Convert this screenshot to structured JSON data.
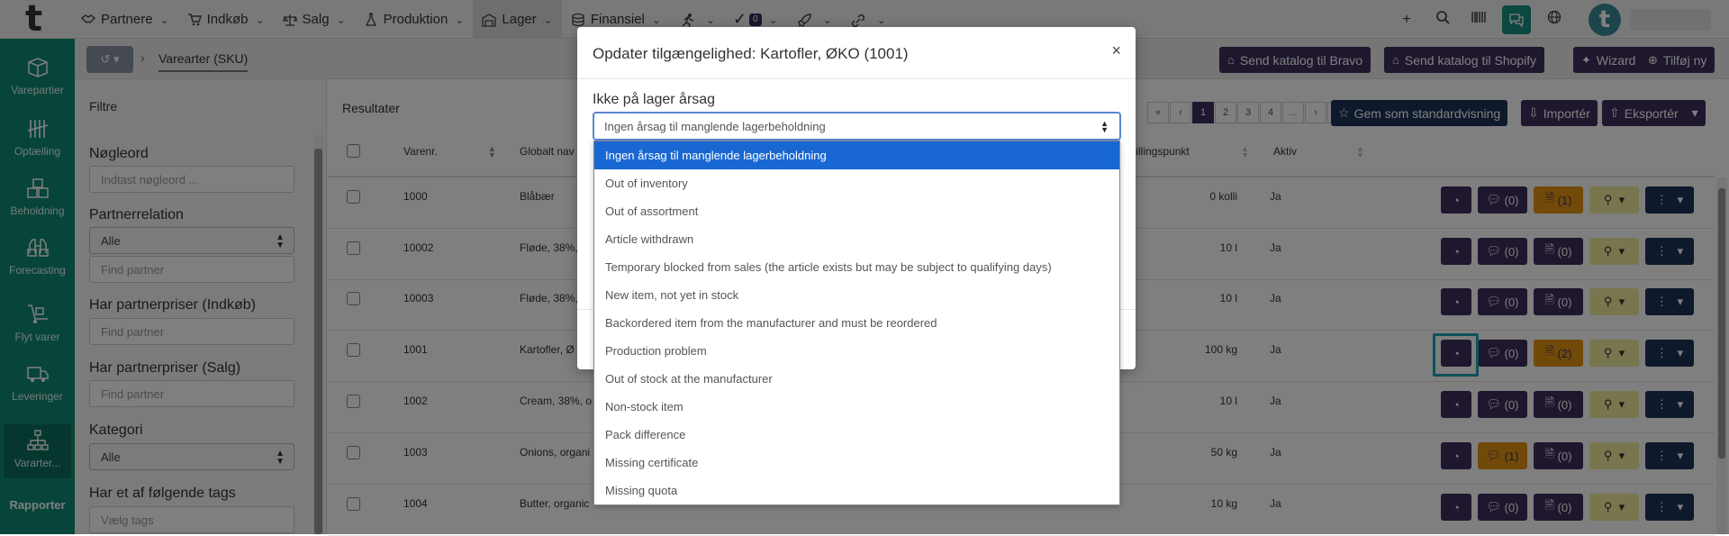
{
  "topnav": {
    "items": [
      {
        "label": "Partnere",
        "icon": "handshake-icon"
      },
      {
        "label": "Indkøb",
        "icon": "cart-icon"
      },
      {
        "label": "Salg",
        "icon": "scale-icon"
      },
      {
        "label": "Produktion",
        "icon": "flask-icon"
      },
      {
        "label": "Lager",
        "icon": "warehouse-icon",
        "active": true
      },
      {
        "label": "Finansiel",
        "icon": "coins-icon"
      }
    ],
    "tasks_badge": "0"
  },
  "sidebar": {
    "items": [
      {
        "label": "Varepartier",
        "icon": "box-icon"
      },
      {
        "label": "Optælling",
        "icon": "tally-icon"
      },
      {
        "label": "Beholdning",
        "icon": "boxes-icon"
      },
      {
        "label": "Forecasting",
        "icon": "binoculars-icon"
      },
      {
        "label": "Flyt varer",
        "icon": "dolly-icon"
      },
      {
        "label": "Leveringer",
        "icon": "truck-icon"
      },
      {
        "label": "Vararter...",
        "icon": "sitemap-icon",
        "active": true
      }
    ],
    "reports_label": "Rapporter"
  },
  "breadcrumb": {
    "current": "Varearter (SKU)"
  },
  "header_buttons": {
    "bravo": "Send katalog til Bravo",
    "shopify": "Send katalog til Shopify",
    "wizard": "Wizard",
    "add": "Tilføj ny"
  },
  "filters": {
    "title": "Filtre",
    "keyword_label": "Nøgleord",
    "keyword_placeholder": "Indtast nøgleord ...",
    "partner_relation_label": "Partnerrelation",
    "partner_relation_value": "Alle",
    "find_partner_placeholder": "Find partner",
    "purchase_prices_label": "Har partnerpriser (Indkøb)",
    "sales_prices_label": "Har partnerpriser (Salg)",
    "category_label": "Kategori",
    "category_value": "Alle",
    "tags_label": "Har et af følgende tags",
    "tags_placeholder": "Vælg tags"
  },
  "results": {
    "title": "Resultater",
    "pages": [
      "«",
      "‹",
      "1",
      "2",
      "3",
      "4",
      "...",
      "›",
      "»"
    ],
    "active_page": "1",
    "save_default": "Gem som standardvisning",
    "import": "Importér",
    "export": "Eksportér",
    "columns": {
      "varenr": "Varenr.",
      "global_name": "Globalt nav",
      "reorder_point": "stillingspunkt",
      "active": "Aktiv"
    },
    "rows": [
      {
        "varenr": "1000",
        "name": "Blåbær",
        "reorder": "0 kolli",
        "active": "Ja",
        "chat": "(0)",
        "docs": "(1)",
        "docs_hl": true,
        "chat_hl": false
      },
      {
        "varenr": "10002",
        "name": "Fløde, 38%,",
        "reorder": "10 l",
        "active": "Ja",
        "chat": "(0)",
        "docs": "(0)",
        "docs_hl": false,
        "chat_hl": false
      },
      {
        "varenr": "10003",
        "name": "Fløde, 38%,",
        "reorder": "10 l",
        "active": "Ja",
        "chat": "(0)",
        "docs": "(0)",
        "docs_hl": false,
        "chat_hl": false
      },
      {
        "varenr": "1001",
        "name": "Kartofler, Ø",
        "reorder": "100 kg",
        "active": "Ja",
        "chat": "(0)",
        "docs": "(2)",
        "docs_hl": true,
        "chat_hl": false
      },
      {
        "varenr": "1002",
        "name": "Cream, 38%, o",
        "reorder": "10 l",
        "active": "Ja",
        "chat": "(0)",
        "docs": "(0)",
        "docs_hl": false,
        "chat_hl": false
      },
      {
        "varenr": "1003",
        "name": "Onions, organi",
        "reorder": "50 kg",
        "active": "Ja",
        "chat": "(1)",
        "docs": "(0)",
        "docs_hl": false,
        "chat_hl": true
      },
      {
        "varenr": "1004",
        "name": "Butter, organic",
        "reorder": "10 kg",
        "active": "Ja",
        "chat": "(0)",
        "docs": "(0)",
        "docs_hl": false,
        "chat_hl": false
      }
    ]
  },
  "modal": {
    "title": "Opdater tilgængelighed: Kartofler, ØKO (1001)",
    "close": "×",
    "reason_label": "Ikke på lager årsag",
    "selected": "Ingen årsag til manglende lagerbeholdning",
    "options": [
      "Ingen årsag til manglende lagerbeholdning",
      "Out of inventory",
      "Out of assortment",
      "Article withdrawn",
      "Temporary blocked from sales (the article exists but may be subject to qualifying days)",
      "New item, not yet in stock",
      "Backordered item from the manufacturer and must be reordered",
      "Production problem",
      "Out of stock at the manufacturer",
      "Non-stock item",
      "Pack difference",
      "Missing certificate",
      "Missing quota"
    ]
  },
  "colors": {
    "teal": "#0f8a74",
    "purple": "#3c2f5c",
    "navy": "#1c3557",
    "orange": "#e39512",
    "select_blue": "#1967d2"
  }
}
